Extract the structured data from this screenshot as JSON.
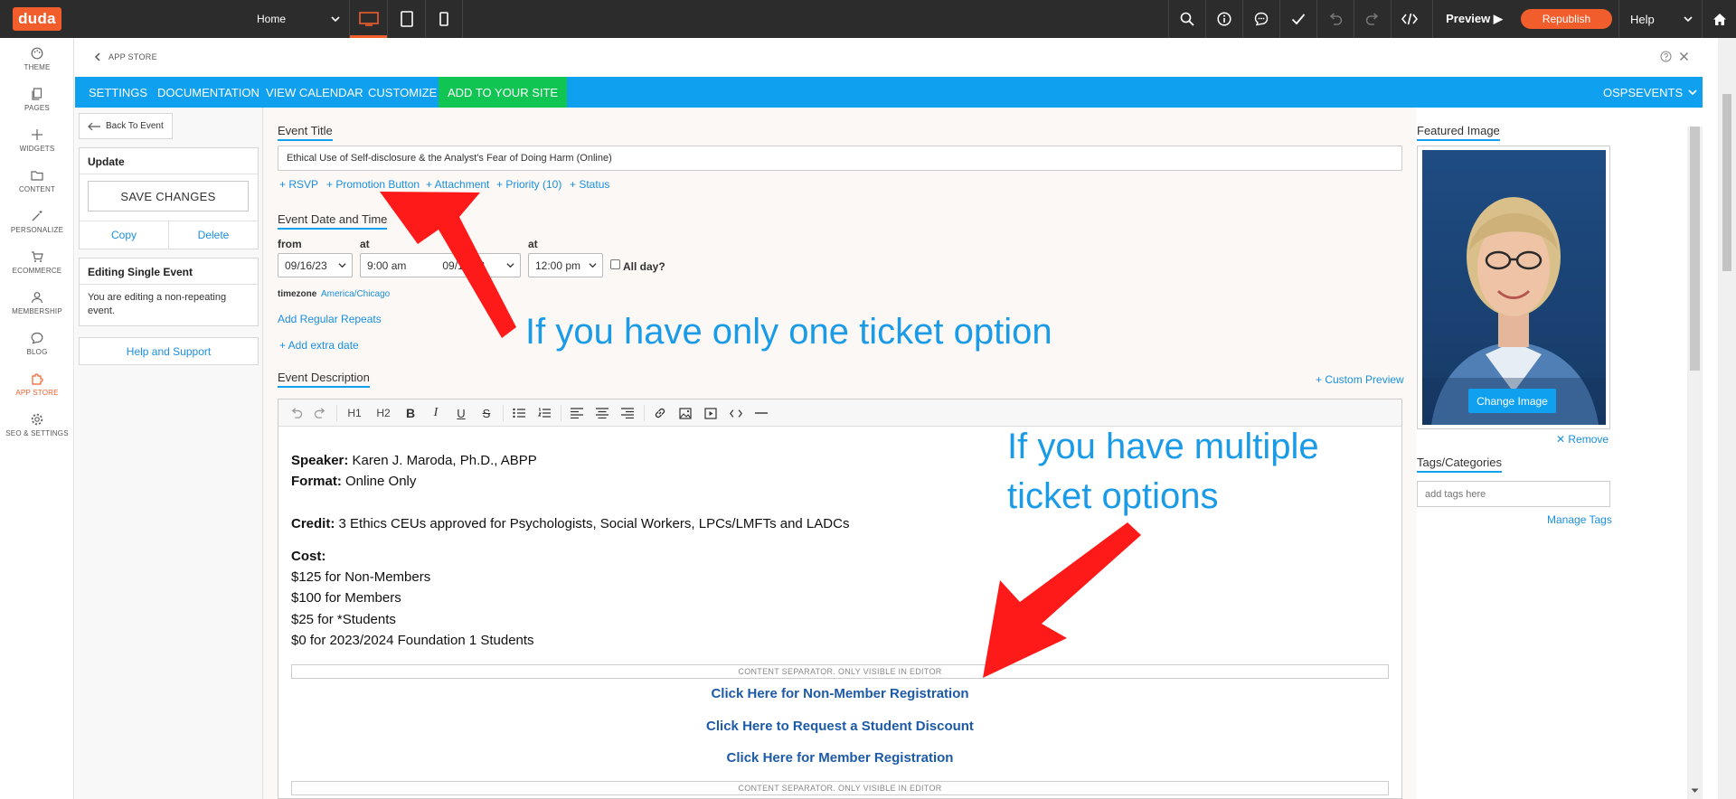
{
  "topbar": {
    "logo": "duda",
    "page_select": "Home",
    "preview": "Preview ▶",
    "republish": "Republish",
    "help": "Help",
    "icons": [
      "desktop-icon",
      "tablet-icon",
      "mobile-icon",
      "search-icon",
      "info-icon",
      "comment-icon",
      "check-icon",
      "undo-icon",
      "redo-icon",
      "code-icon",
      "home-icon"
    ]
  },
  "leftnav": {
    "items": [
      {
        "label": "THEME"
      },
      {
        "label": "PAGES"
      },
      {
        "label": "WIDGETS"
      },
      {
        "label": "CONTENT"
      },
      {
        "label": "PERSONALIZE"
      },
      {
        "label": "ECOMMERCE"
      },
      {
        "label": "MEMBERSHIP"
      },
      {
        "label": "BLOG"
      },
      {
        "label": "APP STORE"
      },
      {
        "label": "SEO & SETTINGS"
      }
    ]
  },
  "header": {
    "breadcrumb": "APP STORE",
    "tabs": [
      "SETTINGS",
      "DOCUMENTATION",
      "VIEW CALENDAR",
      "CUSTOMIZE",
      "ADD TO YOUR SITE"
    ],
    "account": "OSPSEVENTS"
  },
  "sidebar": {
    "back": "Back To Event",
    "update_title": "Update",
    "save": "SAVE CHANGES",
    "copy": "Copy",
    "delete": "Delete",
    "editing_title": "Editing Single Event",
    "editing_text": "You are editing a non-repeating event.",
    "help": "Help and Support"
  },
  "event": {
    "title_label": "Event Title",
    "title_value": "Ethical Use of Self-disclosure & the Analyst's Fear of Doing Harm (Online)",
    "options": [
      "+ RSVP",
      "+ Promotion Button",
      "+ Attachment",
      "+ Priority (10)",
      "+ Status"
    ],
    "date_label": "Event Date and Time",
    "from_label": "from",
    "at_label": "at",
    "from_date": "09/16/23",
    "from_time": "9:00 am",
    "to_date": "09/16/23",
    "to_time": "12:00 pm",
    "allday": "All day?",
    "timezone_label": "timezone",
    "timezone_value": "America/Chicago",
    "add_repeats": "Add Regular Repeats",
    "add_extra": "+ Add extra date",
    "desc_label": "Event Description",
    "custom_preview": "+ Custom Preview"
  },
  "editor": {
    "h1": "H1",
    "h2": "H2",
    "speaker_label": "Speaker:",
    "speaker_value": " Karen J. Maroda, Ph.D., ABPP",
    "format_label": "Format:",
    "format_value": " Online Only",
    "credit_label": "Credit:",
    "credit_value": " 3 Ethics CEUs approved for Psychologists, Social Workers, LPCs/LMFTs and LADCs",
    "cost_label": "Cost:",
    "cost_lines": [
      "$125 for Non-Members",
      "$100 for Members",
      "$25 for *Students",
      "$0 for 2023/2024 Foundation 1 Students"
    ],
    "separator": "CONTENT SEPARATOR. ONLY VISIBLE IN EDITOR",
    "reg_links": [
      "Click Here for Non-Member Registration",
      "Click Here to Request a Student Discount",
      "Click Here for Member Registration"
    ]
  },
  "right": {
    "featured_label": "Featured Image",
    "change_image": "Change Image",
    "remove": "✕ Remove",
    "tags_label": "Tags/Categories",
    "tags_placeholder": "add tags here",
    "manage_tags": "Manage Tags"
  },
  "annotations": {
    "one_ticket": "If you have only one ticket option",
    "multi_ticket_1": "If you have multiple",
    "multi_ticket_2": "ticket options"
  },
  "colors": {
    "accent": "#f25d2c",
    "blue_bar": "#0fa0f0",
    "green": "#10c552",
    "arrow": "#ff0000",
    "annotation": "#1a9be8"
  }
}
